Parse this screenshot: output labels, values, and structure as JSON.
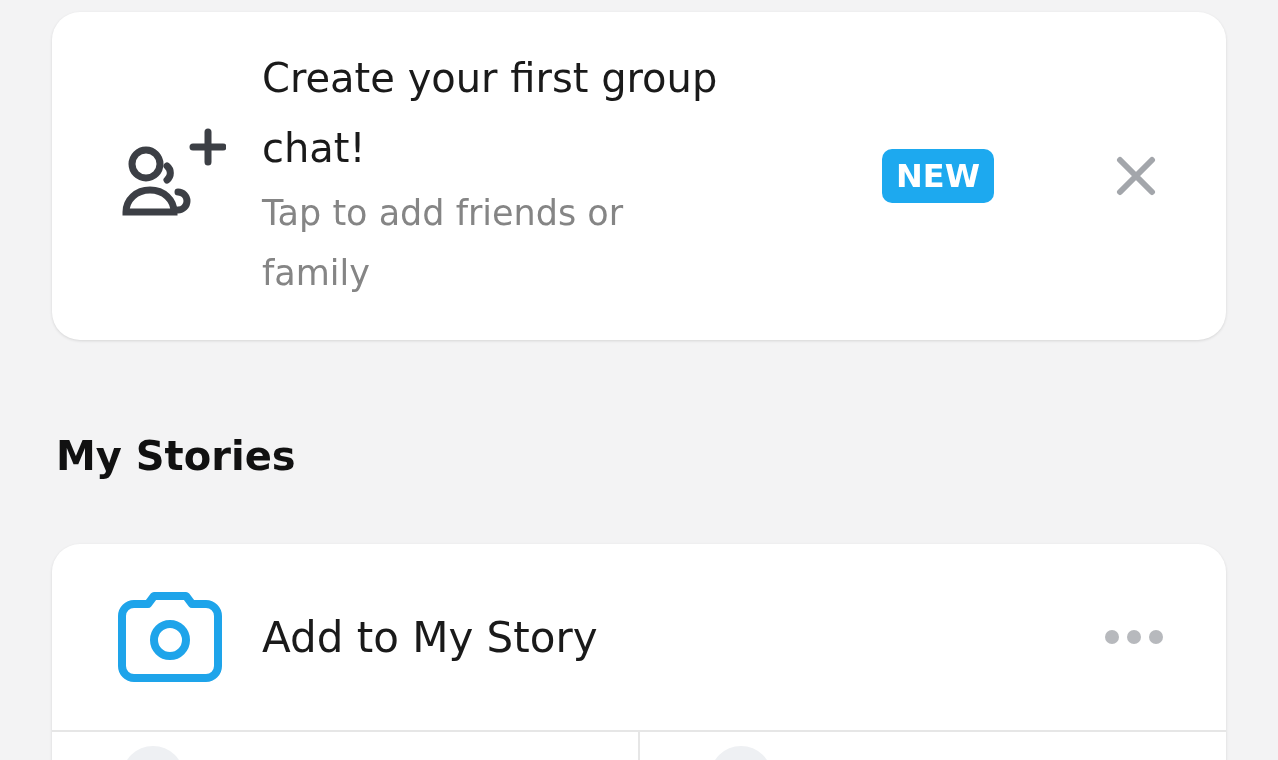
{
  "group_chat_card": {
    "title": "Create your first group chat!",
    "subtitle": "Tap to add friends or family",
    "badge": "NEW"
  },
  "my_stories": {
    "heading": "My Stories",
    "story_card": {
      "label": "Add to My Story"
    }
  }
}
